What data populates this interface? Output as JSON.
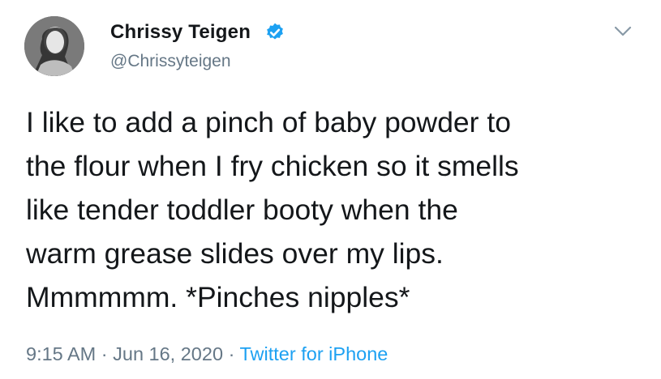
{
  "tweet": {
    "author": {
      "display_name": "Chrissy Teigen",
      "handle": "@Chrissyteigen",
      "verified": true,
      "avatar_icon": "profile-photo"
    },
    "menu_icon": "chevron-down-icon",
    "text": "I like to add a pinch of baby powder to\nthe flour when I fry chicken so it smells\nlike tender toddler booty when the\nwarm grease slides over my lips.\nMmmmmm. *Pinches nipples*",
    "time": "9:15 AM",
    "separator": "·",
    "date": "Jun 16, 2020",
    "source": "Twitter for iPhone"
  },
  "colors": {
    "text_primary": "#14171a",
    "text_secondary": "#657786",
    "link": "#1da1f2",
    "verified": "#1da1f2"
  }
}
